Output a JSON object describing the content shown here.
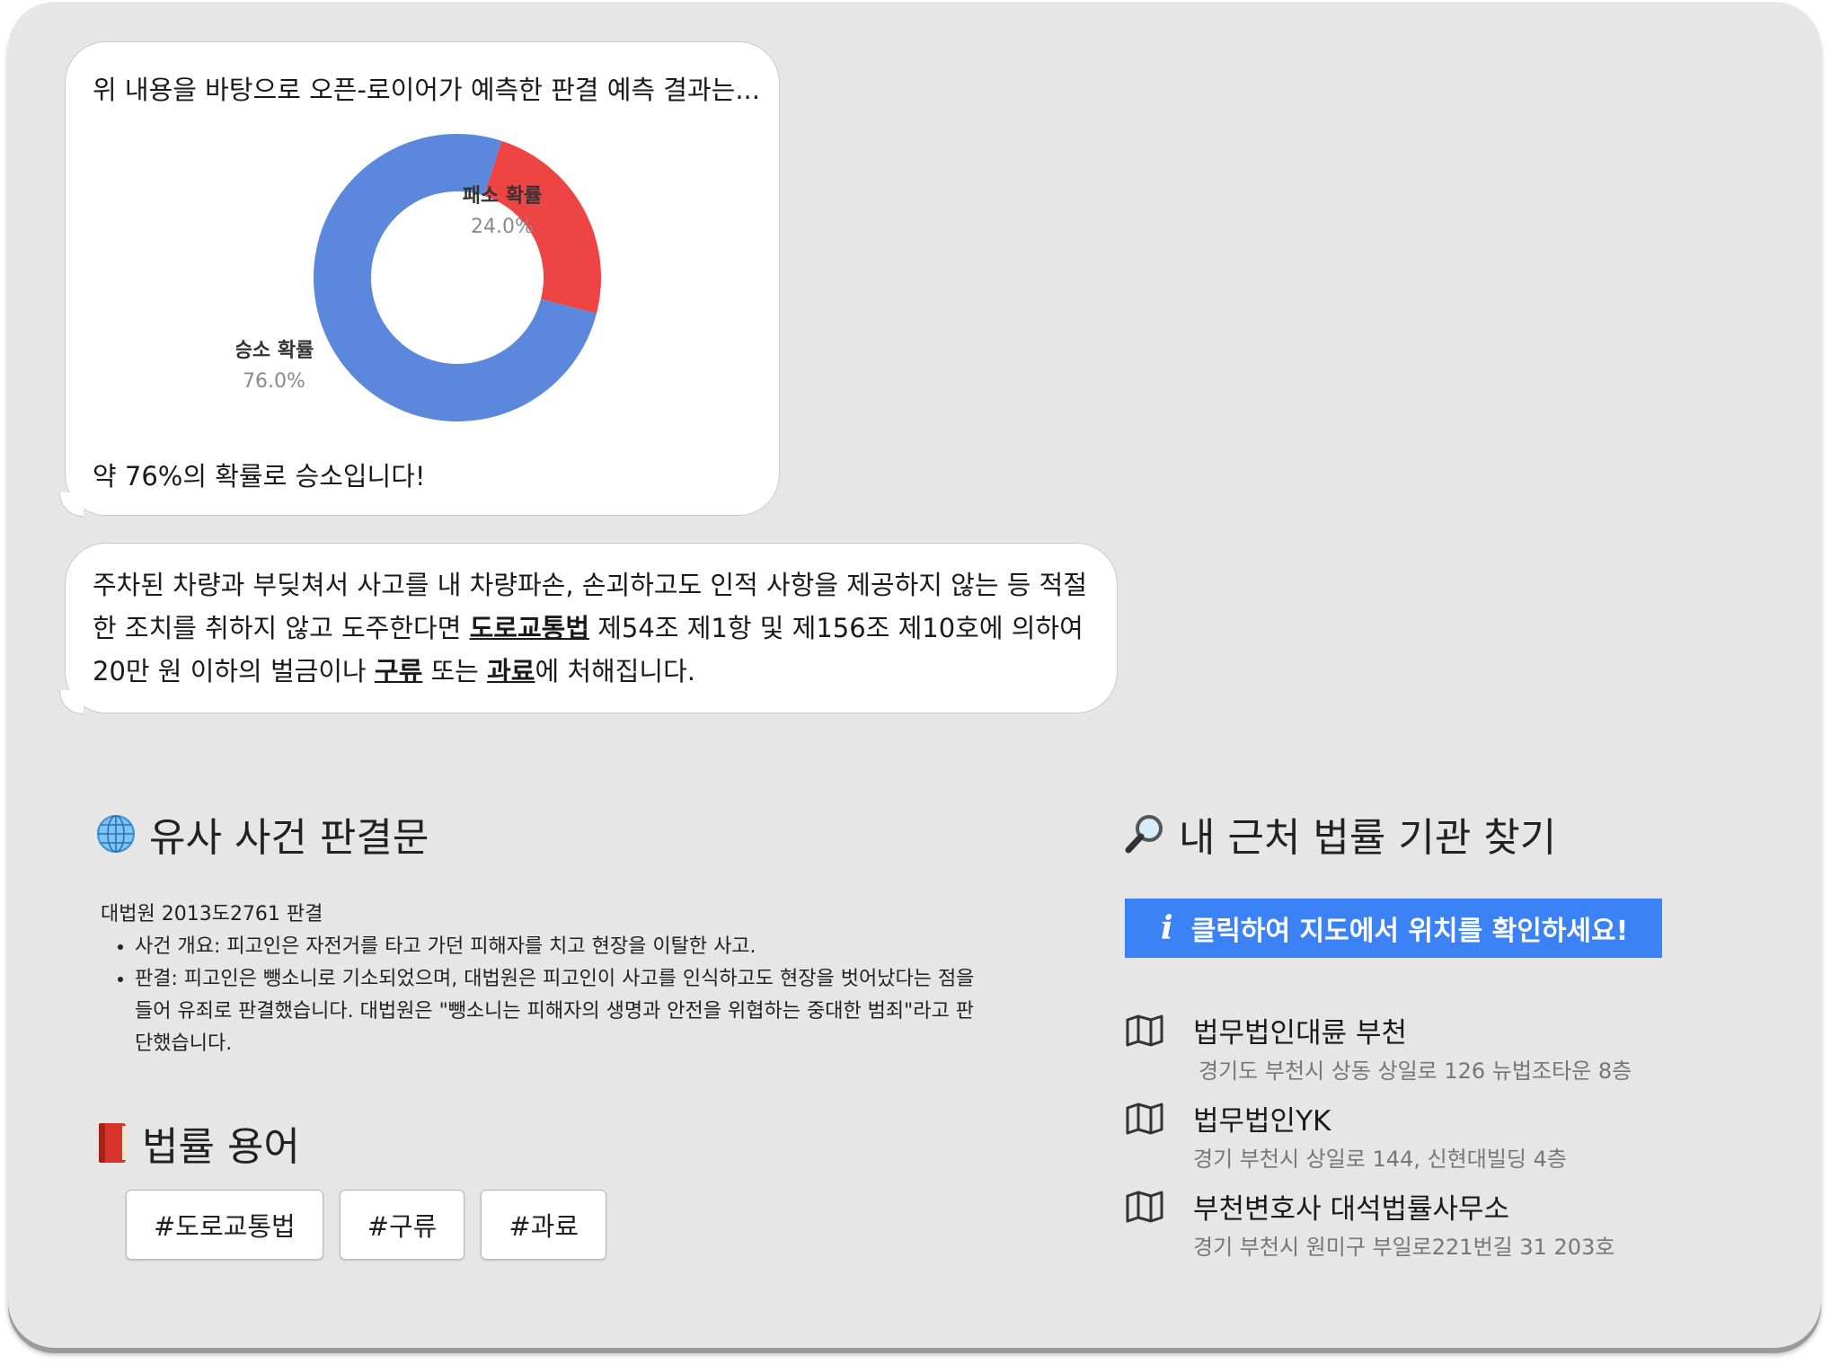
{
  "prediction": {
    "intro": "위 내용을 바탕으로 오픈-로이어가 예측한 판결 예측 결과는...",
    "result": "약 76%의 확률로 승소입니다!"
  },
  "chart_data": {
    "type": "pie",
    "donut": true,
    "slices": [
      {
        "label": "승소 확률",
        "value": 76.0,
        "value_label": "76.0%",
        "color": "#5b87dc"
      },
      {
        "label": "패소 확률",
        "value": 24.0,
        "value_label": "24.0%",
        "color": "#ef4444"
      }
    ]
  },
  "law": {
    "p1": "주차된 차량과 부딪쳐서 사고를 내 차량파손, 손괴하고도 인적 사항을 제공하지 않는 등 적절한 조치를 취하지 않고 도주한다면 ",
    "term1": "도로교통법",
    "p2": " 제54조 제1항 및 제156조 제10호에 의하여 20만 원 이하의 벌금이나 ",
    "term2": "구류",
    "p3": " 또는 ",
    "term3": "과료",
    "p4": "에 처해집니다."
  },
  "similar": {
    "title": "유사 사건 판결문",
    "case_name": "대법원 2013도2761 판결",
    "items": [
      "사건 개요: 피고인은 자전거를 타고 가던 피해자를 치고 현장을 이탈한 사고.",
      "판결: 피고인은 뺑소니로 기소되었으며, 대법원은 피고인이 사고를 인식하고도 현장을 벗어났다는 점을 들어 유죄로 판결했습니다. 대법원은 \"뺑소니는 피해자의 생명과 안전을 위협하는 중대한 범죄\"라고 판단했습니다."
    ]
  },
  "terms": {
    "title": "법률 용어",
    "tags": [
      "#도로교통법",
      "#구류",
      "#과료"
    ]
  },
  "nearby": {
    "title": "내 근처 법률 기관 찾기",
    "map_button": "클릭하여 지도에서 위치를 확인하세요!",
    "places": [
      {
        "name": "법무법인대륜 부천",
        "address": "경기도 부천시 상동 상일로 126 뉴법조타운 8층"
      },
      {
        "name": "법무법인YK",
        "address": "경기 부천시 상일로 144, 신현대빌딩 4층"
      },
      {
        "name": "부천변호사 대석법률사무소",
        "address": "경기 부천시 원미구 부일로221번길 31 203호"
      }
    ]
  },
  "icons": {
    "similar": "globe-icon",
    "terms": "book-icon",
    "nearby": "magnifier-icon",
    "place": "map-icon",
    "info": "info-icon"
  }
}
